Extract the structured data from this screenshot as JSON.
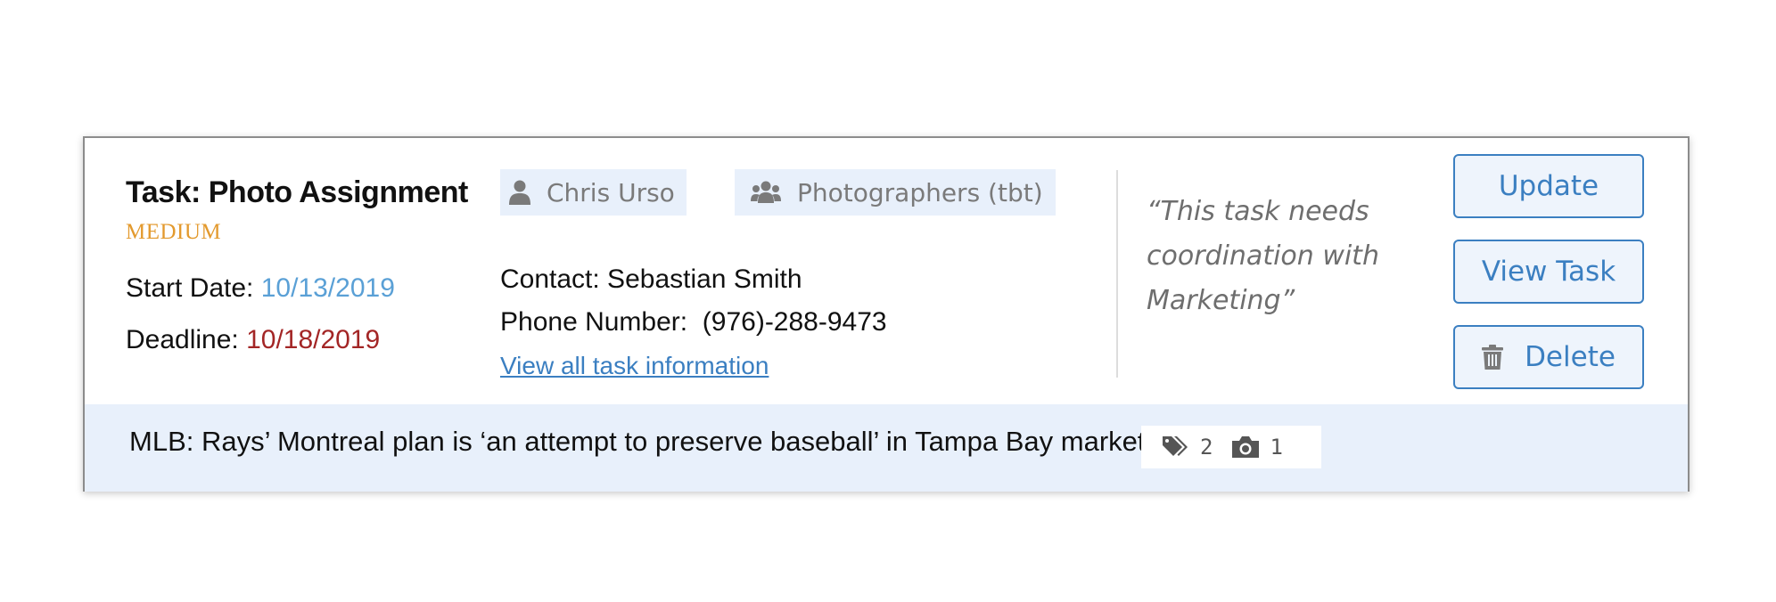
{
  "task": {
    "title": "Task: Photo Assignment",
    "priority": "MEDIUM",
    "start_label": "Start Date: ",
    "start_date": "10/13/2019",
    "deadline_label": "Deadline: ",
    "deadline": "10/18/2019"
  },
  "assignee": {
    "name": "Chris Urso",
    "icon": "user-icon"
  },
  "group": {
    "name": "Photographers (tbt)",
    "icon": "users-icon"
  },
  "contact": {
    "contact_line": "Contact: Sebastian Smith",
    "phone_line": "Phone Number:  (976)-288-9473",
    "link_text": "View all task information"
  },
  "note": {
    "quote": "“This task needs coordination with Marketing”"
  },
  "actions": {
    "update_label": "Update",
    "view_label": "View Task",
    "delete_label": "Delete"
  },
  "story": {
    "headline": "MLB: Rays’ Montreal plan is ‘an attempt to preserve baseball’ in Tampa Bay market",
    "tag_count": "2",
    "photo_count": "1"
  },
  "colors": {
    "priority": "#e39a2e",
    "start_date": "#5aa0d6",
    "deadline": "#a32626",
    "accent": "#3b7fc1",
    "pill_bg": "#e8f0fb"
  }
}
